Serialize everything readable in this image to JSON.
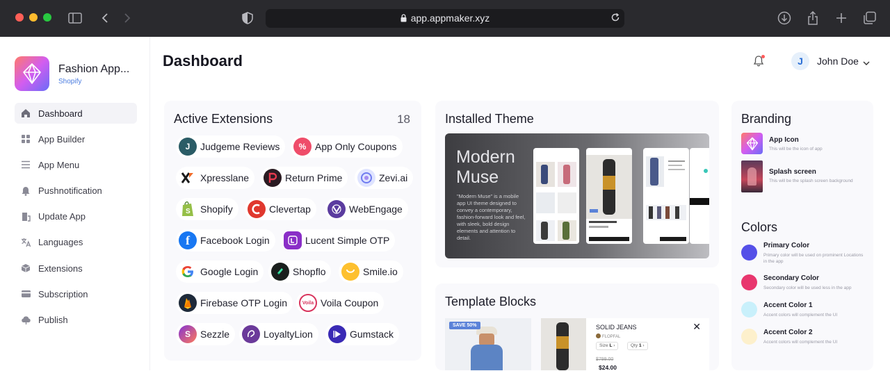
{
  "browser": {
    "url": "app.appmaker.xyz",
    "traffic_colors": [
      "#ff5f57",
      "#febc2e",
      "#28c840"
    ]
  },
  "app": {
    "name": "Fashion App...",
    "platform": "Shopify"
  },
  "sidebar": {
    "items": [
      {
        "label": "Dashboard",
        "icon": "home-icon",
        "active": true
      },
      {
        "label": "App Builder",
        "icon": "grid-icon"
      },
      {
        "label": "App Menu",
        "icon": "menu-icon"
      },
      {
        "label": "Pushnotification",
        "icon": "bell-icon"
      },
      {
        "label": "Update App",
        "icon": "update-icon"
      },
      {
        "label": "Languages",
        "icon": "translate-icon"
      },
      {
        "label": "Extensions",
        "icon": "box-icon"
      },
      {
        "label": "Subscription",
        "icon": "card-icon"
      },
      {
        "label": "Publish",
        "icon": "upload-cloud-icon"
      }
    ]
  },
  "header": {
    "title": "Dashboard",
    "user_initial": "J",
    "user_name": "John Doe"
  },
  "extensions": {
    "title": "Active Extensions",
    "count": "18",
    "items": [
      {
        "label": "Judgeme Reviews",
        "icon": "judgeme-icon",
        "color": "#2b5c66",
        "glyph": "J"
      },
      {
        "label": "App Only Coupons",
        "icon": "coupon-icon",
        "color": "#ef4d6a",
        "glyph": "%"
      },
      {
        "label": "Xpresslane",
        "icon": "xpresslane-icon",
        "color": "#ffffff",
        "glyph": "X"
      },
      {
        "label": "Return Prime",
        "icon": "return-prime-icon",
        "color": "#2a1b22",
        "glyph": "P"
      },
      {
        "label": "Zevi.ai",
        "icon": "zevi-icon",
        "color": "#cfd8ff",
        "glyph": "◉"
      },
      {
        "label": "Shopify",
        "icon": "shopify-icon",
        "color": "#95bf47",
        "glyph": "S"
      },
      {
        "label": "Clevertap",
        "icon": "clevertap-icon",
        "color": "#e0382e",
        "glyph": "C"
      },
      {
        "label": "WebEngage",
        "icon": "webengage-icon",
        "color": "#5b3c9f",
        "glyph": "W"
      },
      {
        "label": "Facebook Login",
        "icon": "facebook-icon",
        "color": "#1877f2",
        "glyph": "f"
      },
      {
        "label": "Lucent Simple OTP",
        "icon": "lucent-icon",
        "color": "#8a2ec7",
        "glyph": "L"
      },
      {
        "label": "Google Login",
        "icon": "google-icon",
        "color": "#ffffff",
        "glyph": "G"
      },
      {
        "label": "Shopflo",
        "icon": "shopflo-icon",
        "color": "#1a1f1d",
        "glyph": "S"
      },
      {
        "label": "Smile.io",
        "icon": "smile-icon",
        "color": "#fdc02f",
        "glyph": "◡"
      },
      {
        "label": "Firebase OTP Login",
        "icon": "firebase-icon",
        "color": "#1e2a3a",
        "glyph": "▲"
      },
      {
        "label": "Voila Coupon",
        "icon": "voila-icon",
        "color": "#ffffff",
        "glyph": "Voila"
      },
      {
        "label": "Sezzle",
        "icon": "sezzle-icon",
        "color": "#8333d4",
        "glyph": "S"
      },
      {
        "label": "LoyaltyLion",
        "icon": "loyaltylion-icon",
        "color": "#6b3a9a",
        "glyph": "L"
      },
      {
        "label": "Gumstack",
        "icon": "gumstack-icon",
        "color": "#3a2ab5",
        "glyph": "▶"
      }
    ]
  },
  "theme": {
    "title": "Installed Theme",
    "name": "Modern Muse",
    "description": "\"Modern Muse\" is a mobile app UI theme designed to convey a contemporary, fashion-forward look and feel, with sleek, bold design elements and attention to detail."
  },
  "template_blocks": {
    "title": "Template Blocks",
    "save_tag": "SAVE 50%",
    "product_title": "SOLID JEANS",
    "product_brand": "FLOPFAL",
    "size_label": "Size",
    "size_value": "L",
    "qty_label": "Qty",
    "qty_value": "1",
    "old_price": "$799.00",
    "new_price": "$24.00"
  },
  "branding": {
    "title": "Branding",
    "app_icon_label": "App Icon",
    "app_icon_desc": "This will be the icon of app",
    "splash_label": "Splash screen",
    "splash_desc": "This will be the splash screen background"
  },
  "colors": {
    "title": "Colors",
    "items": [
      {
        "label": "Primary Color",
        "desc": "Primary color will be used on prominent Locations in the app",
        "color": "#5550e8"
      },
      {
        "label": "Secondary Color",
        "desc": "Secondary color will be used less in the app",
        "color": "#e8366e"
      },
      {
        "label": "Accent Color 1",
        "desc": "Accent colors will complement the UI",
        "color": "#c9f0fb"
      },
      {
        "label": "Accent Color 2",
        "desc": "Accent colors will complement the UI",
        "color": "#fdf0cc"
      }
    ]
  }
}
